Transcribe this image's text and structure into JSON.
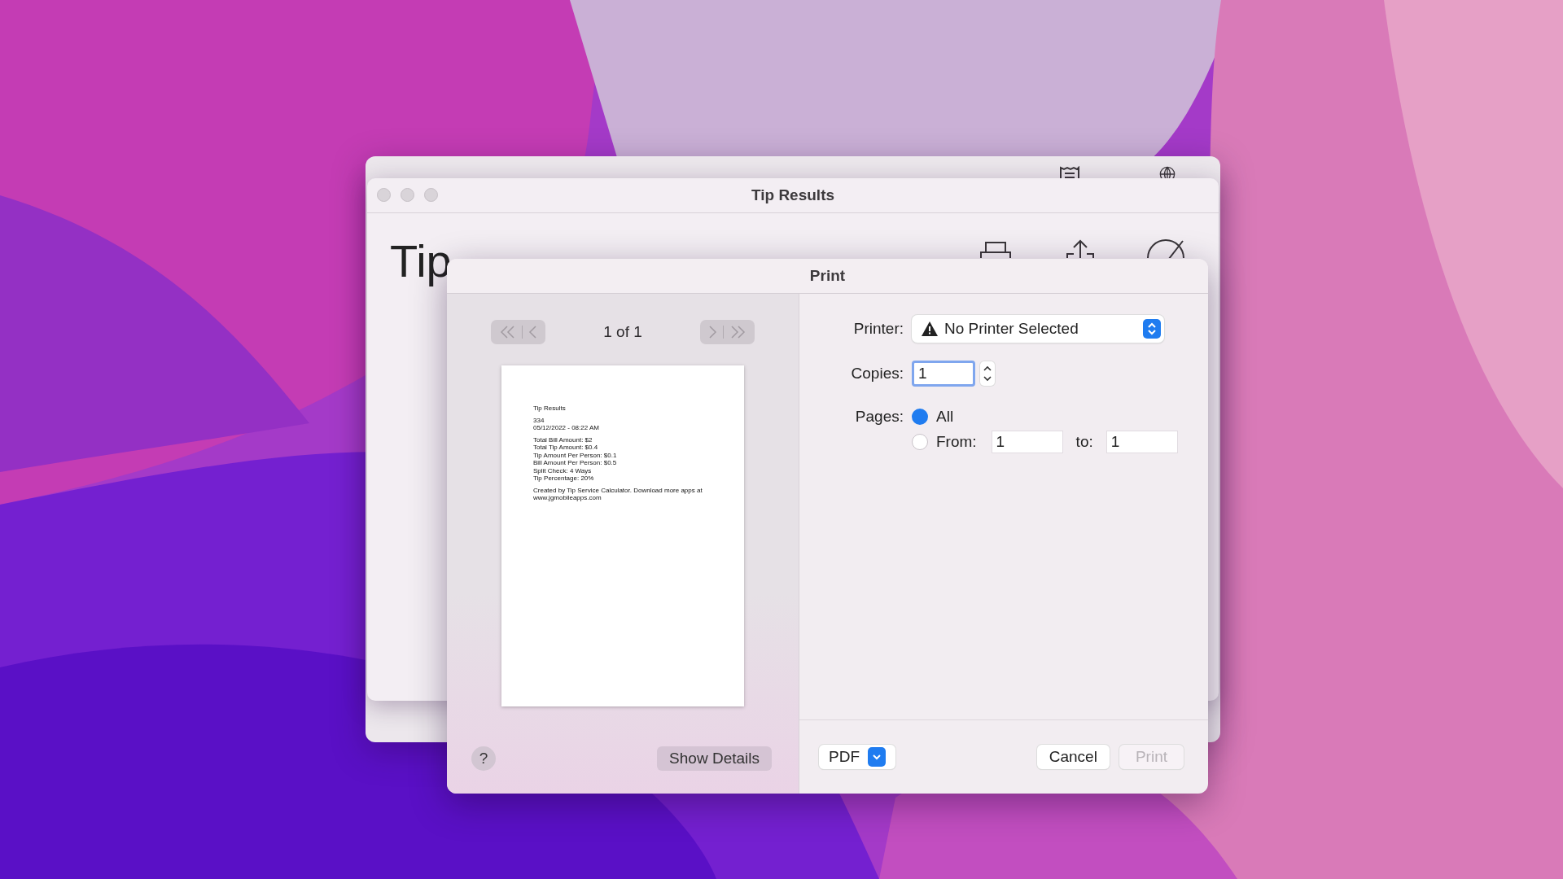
{
  "back_window": {
    "kind": "sheet"
  },
  "window": {
    "title": "Tip Results",
    "heading": "Tip"
  },
  "print_dialog": {
    "title": "Print",
    "page_counter": "1 of 1",
    "preview": {
      "blocks": [
        [
          "Tip Results"
        ],
        [
          "334",
          "05/12/2022 - 08:22 AM"
        ],
        [
          "Total Bill Amount: $2",
          "Total Tip Amount: $0.4",
          "Tip Amount Per Person: $0.1",
          "Bill Amount Per Person: $0.5",
          "Split Check: 4 Ways",
          "Tip Percentage: 20%"
        ],
        [
          "Created by Tip Service Calculator. Download more apps at www.jgmobileapps.com"
        ]
      ]
    },
    "help": "?",
    "show_details": "Show Details",
    "printer": {
      "label": "Printer:",
      "value": "No Printer Selected"
    },
    "copies": {
      "label": "Copies:",
      "value": "1"
    },
    "pages": {
      "label": "Pages:",
      "options": [
        {
          "label": "All",
          "selected": true
        },
        {
          "label": "From:",
          "selected": false
        }
      ],
      "from": "1",
      "to_label": "to:",
      "to": "1"
    },
    "pdf": "PDF",
    "buttons": [
      {
        "label": "Cancel",
        "disabled": false
      },
      {
        "label": "Print",
        "disabled": true
      }
    ]
  }
}
